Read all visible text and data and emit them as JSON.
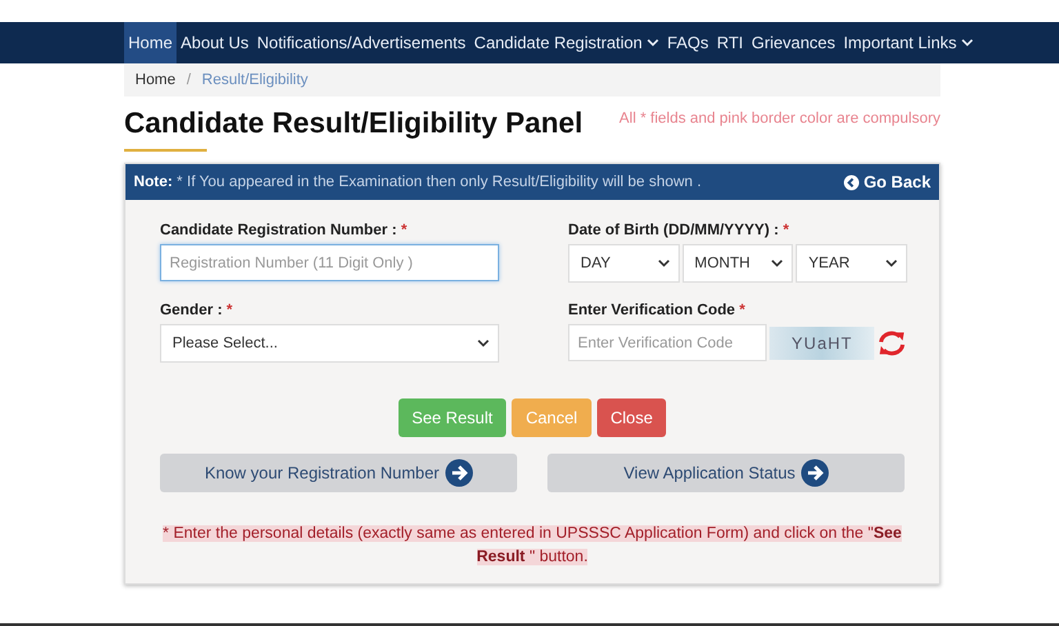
{
  "nav": [
    {
      "label": "Home",
      "selected": true,
      "dropdown": false
    },
    {
      "label": "About Us",
      "selected": false,
      "dropdown": false
    },
    {
      "label": "Notifications/Advertisements",
      "selected": false,
      "dropdown": false
    },
    {
      "label": "Candidate Registration",
      "selected": false,
      "dropdown": true
    },
    {
      "label": "FAQs",
      "selected": false,
      "dropdown": false
    },
    {
      "label": "RTI",
      "selected": false,
      "dropdown": false
    },
    {
      "label": "Grievances",
      "selected": false,
      "dropdown": false
    },
    {
      "label": "Important Links",
      "selected": false,
      "dropdown": true
    }
  ],
  "breadcrumb": [
    "Home",
    "Result/Eligibility"
  ],
  "breadcrumb_separator": "/",
  "title": "Candidate Result/Eligibility Panel",
  "compulsory_note": "All * fields and pink border color are compulsory",
  "panel": {
    "note_label": "Note:",
    "note": "* If You appeared in the Examination then only Result/Eligibility will be shown .",
    "go_back": "Go Back"
  },
  "fields": {
    "registration": {
      "label": "Candidate Registration Number :",
      "required": "*",
      "placeholder": "Registration Number (11 Digit Only )"
    },
    "dob": {
      "label": "Date of Birth (DD/MM/YYYY) :",
      "required": "*",
      "selects": [
        "DAY",
        "MONTH",
        "YEAR"
      ]
    },
    "gender": {
      "label": "Gender :",
      "required": "*",
      "value": "Please Select..."
    },
    "captcha": {
      "label": "Enter Verification Code",
      "required": "*",
      "placeholder": "Enter Verification Code",
      "code": "YUaHT"
    }
  },
  "buttons": [
    {
      "label": "See Result",
      "color": "#5cb85c"
    },
    {
      "label": "Cancel",
      "color": "#f0ad4e"
    },
    {
      "label": "Close",
      "color": "#d9534f"
    }
  ],
  "links": [
    "Know your Registration Number",
    "View Application Status"
  ],
  "instruction": "* Enter the personal details (exactly same as entered in UPSSSC Application Form) and click on the \"**See Result** \" button."
}
